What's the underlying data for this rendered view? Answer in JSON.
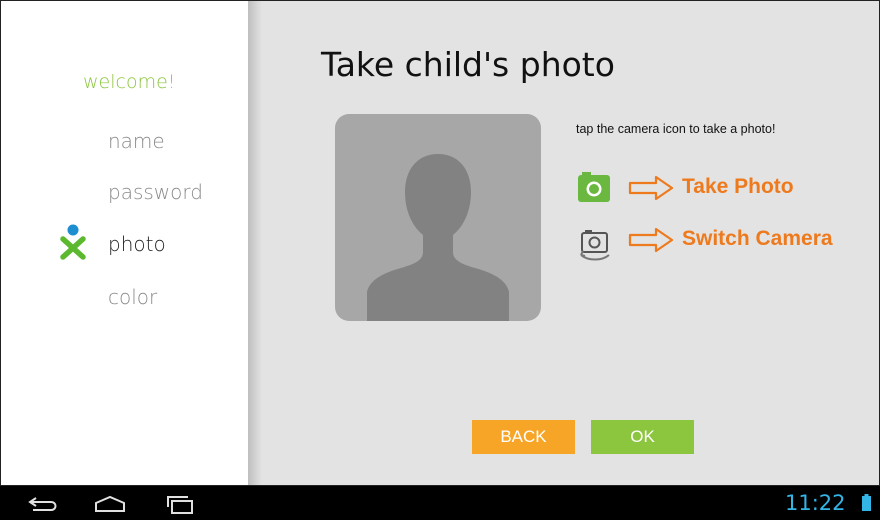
{
  "sidebar": {
    "steps": [
      {
        "label": "welcome!"
      },
      {
        "label": "name"
      },
      {
        "label": "password"
      },
      {
        "label": "photo",
        "active": true,
        "icon": "xo-person-icon"
      },
      {
        "label": "color"
      }
    ]
  },
  "main": {
    "title": "Take child's photo",
    "hint": "tap the camera icon to take a photo!",
    "photo_placeholder_icon": "person-silhouette-icon",
    "take_photo": {
      "icon": "camera-icon",
      "label": "Take Photo"
    },
    "switch_camera": {
      "icon": "switch-camera-icon",
      "label": "Switch Camera"
    },
    "buttons": {
      "back": "BACK",
      "ok": "OK"
    }
  },
  "system_bar": {
    "time": "11:22",
    "icons": [
      "back-icon",
      "home-icon",
      "recent-apps-icon",
      "battery-icon"
    ]
  },
  "colors": {
    "welcome_green": "#8cc63f",
    "back_orange": "#f7a527",
    "ok_green": "#8cc63f",
    "annotation_orange": "#ee7a1e",
    "clock_blue": "#33b5e5"
  }
}
